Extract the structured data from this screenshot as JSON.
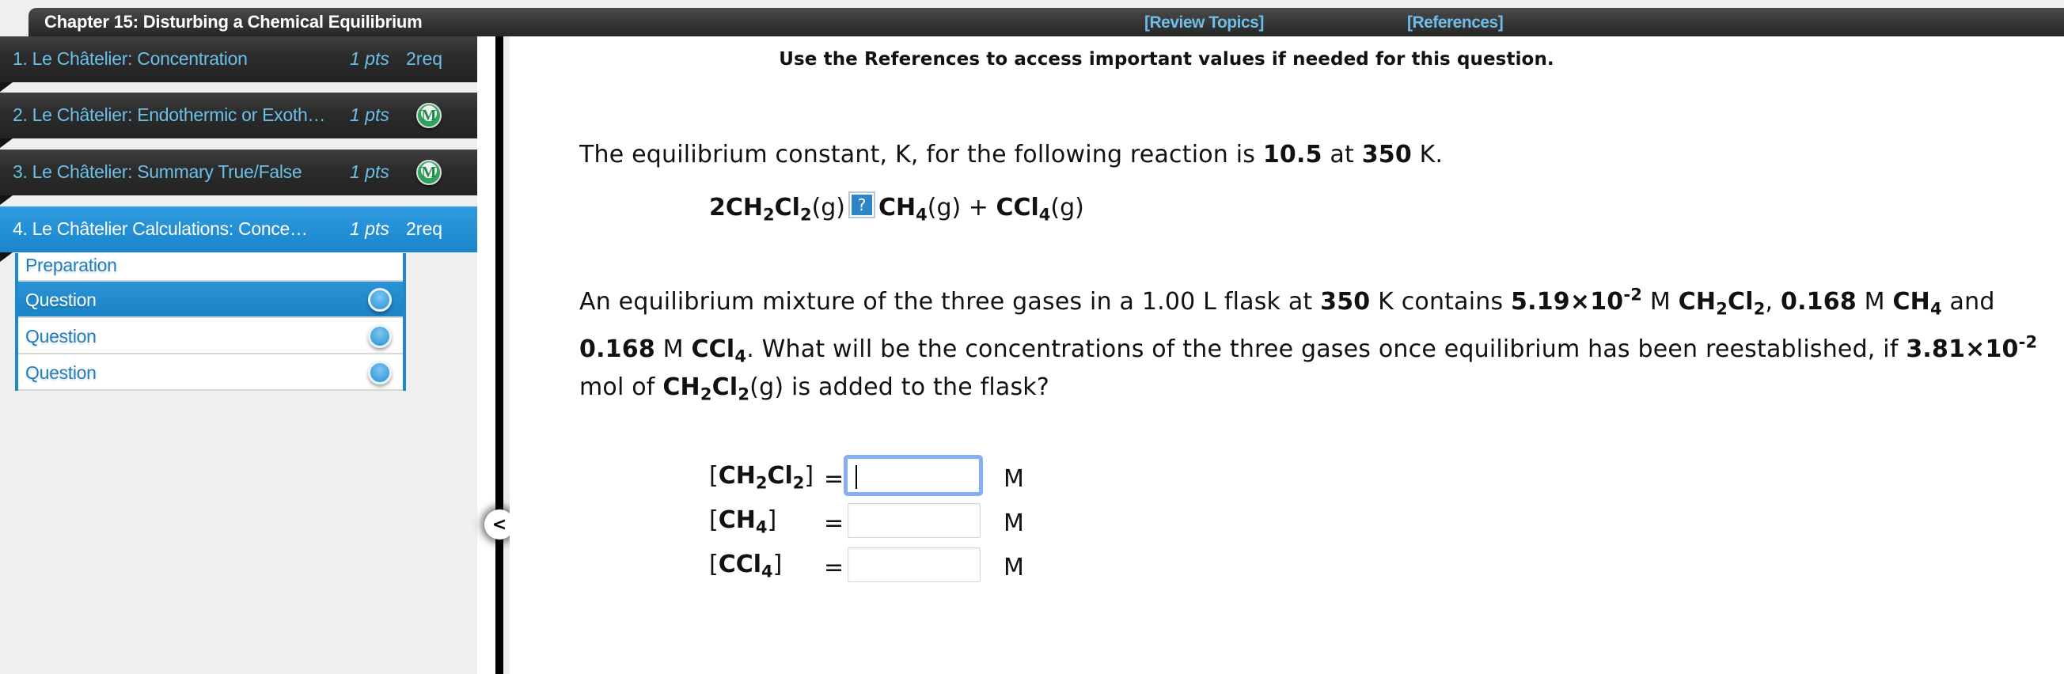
{
  "header": {
    "chapter_title": "Chapter 15: Disturbing a Chemical Equilibrium",
    "links": [
      "[Review Topics]",
      "[References]"
    ]
  },
  "sidebar": {
    "assignments": [
      {
        "label": "1. Le Châtelier: Concentration",
        "points": "1 pts",
        "status": "2req",
        "active": false
      },
      {
        "label": "2. Le Châtelier: Endothermic or Exoth…",
        "points": "1 pts",
        "status": "M-badge",
        "active": false
      },
      {
        "label": "3. Le Châtelier: Summary True/False",
        "points": "1 pts",
        "status": "M-badge",
        "active": false
      },
      {
        "label": "4. Le Châtelier Calculations: Conce…",
        "points": "1 pts",
        "status": "2req",
        "active": true
      }
    ],
    "badge_letter": "M",
    "sub_items": [
      {
        "label": "Preparation",
        "active": false,
        "has_radio": false
      },
      {
        "label": "Question",
        "active": true,
        "has_radio": true
      },
      {
        "label": "Question",
        "active": false,
        "has_radio": true
      },
      {
        "label": "Question",
        "active": false,
        "has_radio": true
      }
    ],
    "collapse_glyph": "<"
  },
  "main": {
    "ref_note": "Use the References to access important values if needed for this question.",
    "intro": {
      "t1": "The equilibrium constant, K, for the following reaction is ",
      "k_value": "10.5",
      "t2": " at ",
      "temp": "350",
      "t3": " K."
    },
    "equation": {
      "reactant_coef": "2",
      "missing_arrow_glyph": "?",
      "phase": "(g)",
      "plus": " + "
    },
    "problem": {
      "l1a": "An equilibrium mixture of the three gases in a 1.00 L flask at ",
      "temp": "350",
      "l1b": " K contains ",
      "c_ch2cl2_mant": "5.19×10",
      "c_ch2cl2_exp": "-2",
      "unit_m": " M ",
      "comma": ",   ",
      "c_ch4": "0.168",
      "and": " and",
      "c_ccl4": "0.168",
      "l2b": ". What will be the concentrations of the three gases once equilibrium has been reestablished, if ",
      "added_mant": "3.81×10",
      "added_exp": "-2",
      "l3a": "mol of ",
      "l3b": "(g) is added to the flask?"
    },
    "answers": [
      {
        "species": "CH2Cl2",
        "value": "",
        "unit": "M",
        "focused": true
      },
      {
        "species": "CH4",
        "value": "",
        "unit": "M",
        "focused": false
      },
      {
        "species": "CCl4",
        "value": "",
        "unit": "M",
        "focused": false
      }
    ],
    "equals": "="
  }
}
